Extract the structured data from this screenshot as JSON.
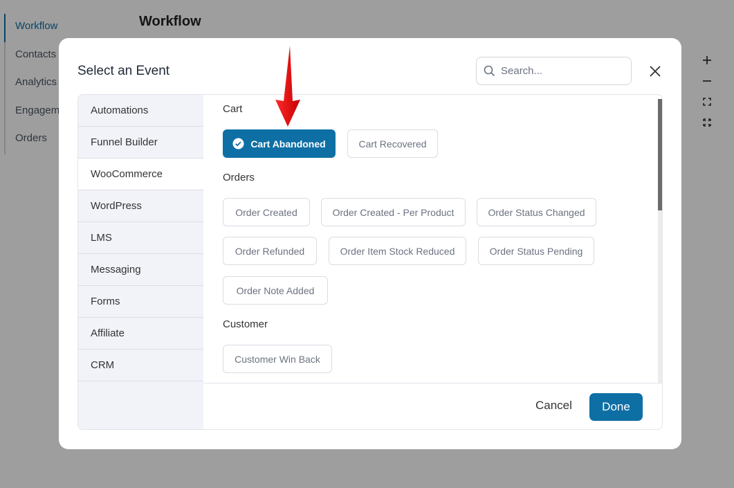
{
  "background": {
    "nav": [
      "Workflow",
      "Contacts",
      "Analytics",
      "Engagement",
      "Orders"
    ],
    "page_title": "Workflow",
    "zoom": {
      "zoom_in_icon": "plus-icon",
      "zoom_out_icon": "minus-icon",
      "fit_icon": "fit-screen-icon",
      "fullscreen_icon": "fullscreen-icon"
    }
  },
  "modal": {
    "title": "Select an Event",
    "search_placeholder": "Search...",
    "categories": [
      {
        "label": "Automations"
      },
      {
        "label": "Funnel Builder"
      },
      {
        "label": "WooCommerce",
        "active": true
      },
      {
        "label": "WordPress"
      },
      {
        "label": "LMS"
      },
      {
        "label": "Messaging"
      },
      {
        "label": "Forms"
      },
      {
        "label": "Affiliate"
      },
      {
        "label": "CRM"
      }
    ],
    "groups": {
      "cart": {
        "label": "Cart",
        "events": [
          {
            "label": "Cart Abandoned",
            "selected": true
          },
          {
            "label": "Cart Recovered"
          }
        ]
      },
      "orders": {
        "label": "Orders",
        "events": [
          {
            "label": "Order Created"
          },
          {
            "label": "Order Created - Per Product"
          },
          {
            "label": "Order Status Changed"
          },
          {
            "label": "Order Refunded"
          },
          {
            "label": "Order Item Stock Reduced"
          },
          {
            "label": "Order Status Pending"
          },
          {
            "label": "Order Note Added"
          }
        ]
      },
      "customer": {
        "label": "Customer",
        "events": [
          {
            "label": "Customer Win Back"
          }
        ]
      }
    },
    "footer": {
      "cancel_label": "Cancel",
      "done_label": "Done"
    }
  },
  "colors": {
    "accent": "#0e6fa5",
    "annotation_arrow": "#e00000"
  }
}
